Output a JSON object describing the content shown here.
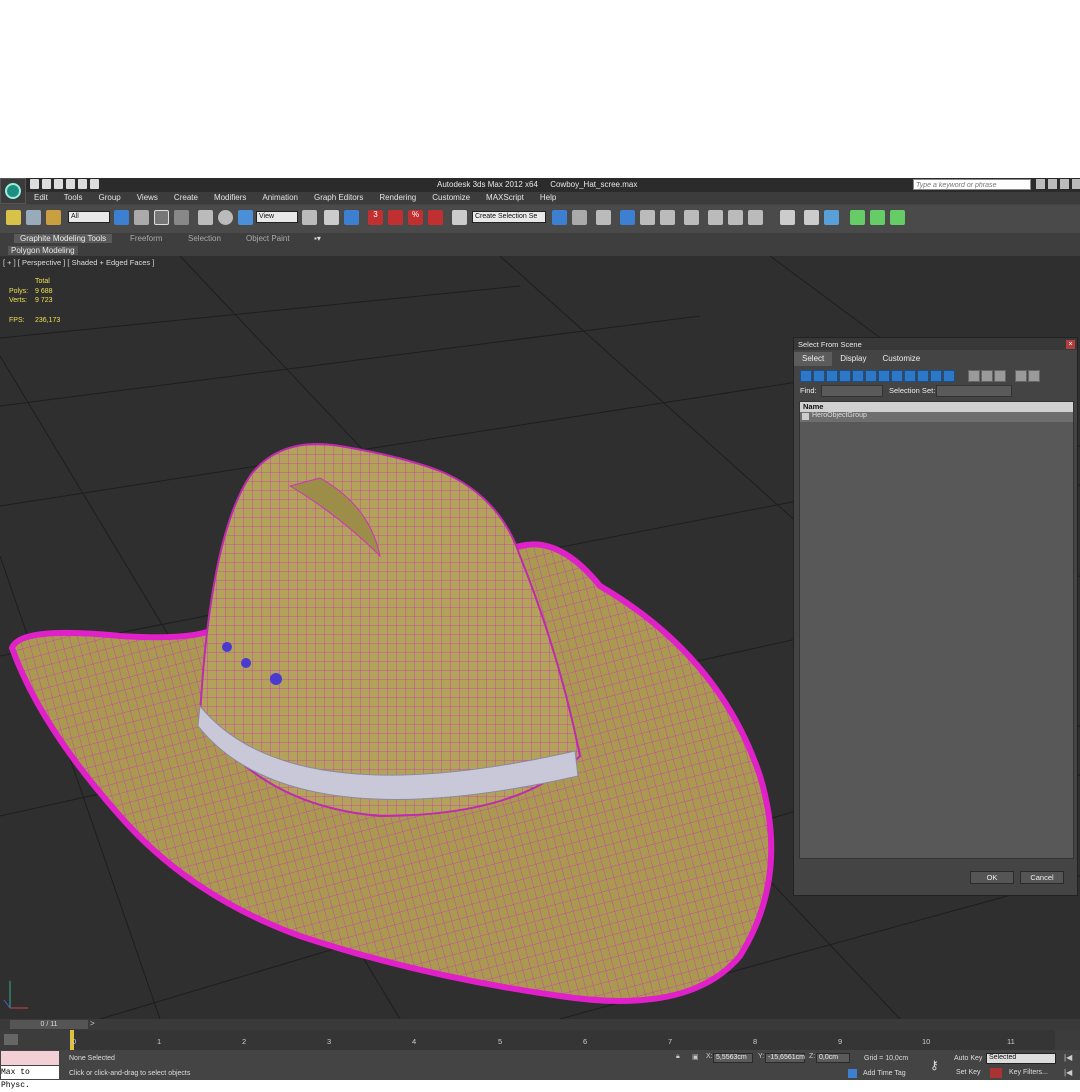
{
  "window": {
    "app_name": "Autodesk 3ds Max  2012 x64",
    "file_name": "Cowboy_Hat_scree.max",
    "search_placeholder": "Type a keyword or phrase"
  },
  "menu": [
    "Edit",
    "Tools",
    "Group",
    "Views",
    "Create",
    "Modifiers",
    "Animation",
    "Graph Editors",
    "Rendering",
    "Customize",
    "MAXScript",
    "Help"
  ],
  "toolbar": {
    "filter_value": "All",
    "ref_coord_value": "View",
    "selection_set_placeholder": "Create Selection Se",
    "snap_label": "3",
    "angle_snap_label": "%"
  },
  "ribbon": {
    "tabs": [
      "Graphite Modeling Tools",
      "Freeform",
      "Selection",
      "Object Paint"
    ],
    "sub_tab": "Polygon Modeling"
  },
  "viewport": {
    "label": "[ + ] [ Perspective ] [ Shaded + Edged Faces ]",
    "stats": {
      "total_label": "Total",
      "polys_label": "Polys:",
      "polys_value": "9 688",
      "verts_label": "Verts:",
      "verts_value": "9 723",
      "fps_label": "FPS:",
      "fps_value": "236,173"
    },
    "colors": {
      "hat": "#b9a85a",
      "wire": "#e020c8",
      "band": "#c8c8d8",
      "background": "#2f2f2f"
    }
  },
  "dialog": {
    "title": "Select From Scene",
    "menus": [
      "Select",
      "Display",
      "Customize"
    ],
    "find_label": "Find:",
    "selection_set_label": "Selection Set:",
    "column_name": "Name",
    "items": [
      "HeroObjectGroup"
    ],
    "ok_label": "OK",
    "cancel_label": "Cancel"
  },
  "timeline": {
    "slider_label": "0 / 11",
    "ticks": [
      "0",
      "1",
      "2",
      "3",
      "4",
      "5",
      "6",
      "7",
      "8",
      "9",
      "10",
      "11"
    ]
  },
  "status": {
    "maxscript": "Max to Physc.",
    "selection": "None Selected",
    "prompt": "Click or click-and-drag to select objects",
    "x_label": "X:",
    "x_value": "5,5563cm",
    "y_label": "Y:",
    "y_value": "-15,6561cm",
    "z_label": "Z:",
    "z_value": "0,0cm",
    "grid": "Grid = 10,0cm",
    "add_time_tag": "Add Time Tag",
    "auto_key": "Auto Key",
    "auto_key_mode": "Selected",
    "set_key": "Set Key",
    "key_filters": "Key Filters..."
  }
}
